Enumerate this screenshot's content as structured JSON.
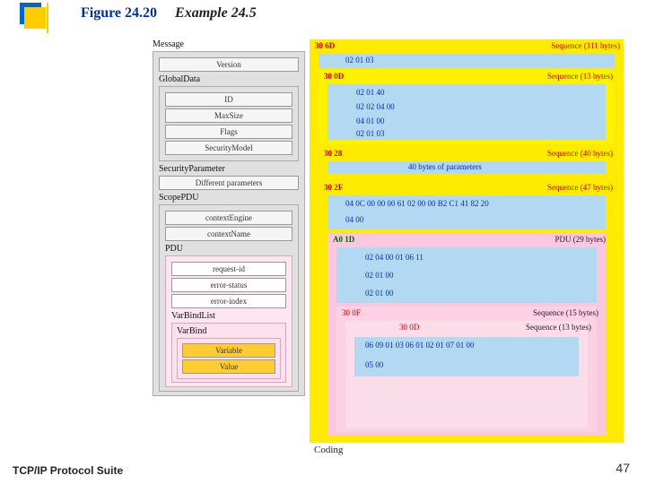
{
  "title": {
    "figure": "Figure 24.20",
    "example": "Example 24.5"
  },
  "footer": "TCP/IP Protocol Suite",
  "pagenum": "47",
  "coding_label": "Coding",
  "left": {
    "message": "Message",
    "version": "Version",
    "globaldata": "GlobalData",
    "id": "ID",
    "maxsize": "MaxSize",
    "flags": "Flags",
    "securitymodel": "SecurityModel",
    "securityparam": "SecurityParameter",
    "diffparams": "Different parameters",
    "scopepdu": "ScopePDU",
    "contextengine": "contextEngine",
    "contextname": "contextName",
    "pdu": "PDU",
    "requestid": "request-id",
    "errorstatus": "error-status",
    "errorindex": "error-index",
    "varbindlist": "VarBindList",
    "varbind": "VarBind",
    "variable": "Variable",
    "value": "Value"
  },
  "right": {
    "msg_hdr": "30 6D",
    "msg_seq": "Sequence (111 bytes)",
    "ver_val": "02 01 03",
    "glob_hdr": "30 0D",
    "glob_seq": "Sequence (13 bytes)",
    "id_val": "02 01 40",
    "max_val": "02 02 04 00",
    "flags_val": "04 01 00",
    "sec_val": "02 01 03",
    "secp_hdr": "30 28",
    "secp_seq": "Sequence (40 bytes)",
    "secp_note": "40 bytes of parameters",
    "scope_hdr": "30 2F",
    "scope_seq": "Sequence (47 bytes)",
    "ceng_val": "04 0C 00 00 00 61 02 00 00 B2 C1 41 82 20",
    "cname_val": "04 00",
    "pdu_hdr": "A0 1D",
    "pdu_seq": "PDU (29 bytes)",
    "reqid_val": "02 04 00 01 06 11",
    "errs_val": "02 01 00",
    "erri_val": "02 01 00",
    "vbl_hdr": "30 0F",
    "vbl_seq": "Sequence (15 bytes)",
    "vb_hdr": "30 0D",
    "vb_seq": "Sequence (13 bytes)",
    "var_val": "06 09 01 03 06 01 02 01 07 01 00",
    "val_val": "05 00"
  }
}
